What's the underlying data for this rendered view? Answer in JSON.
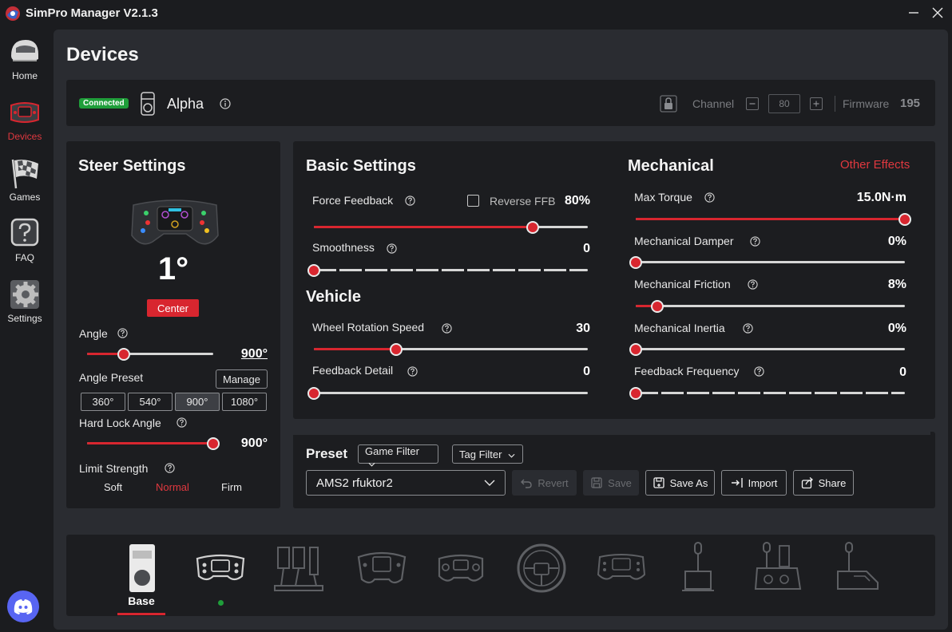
{
  "window": {
    "title": "SimPro Manager V2.1.3"
  },
  "nav": {
    "items": [
      {
        "label": "Home",
        "icon": "helmet-icon"
      },
      {
        "label": "Devices",
        "icon": "wheel-icon"
      },
      {
        "label": "Games",
        "icon": "checkered-flag-icon"
      },
      {
        "label": "FAQ",
        "icon": "question-icon"
      },
      {
        "label": "Settings",
        "icon": "gear-icon"
      }
    ],
    "active": "Devices"
  },
  "page": {
    "title": "Devices"
  },
  "device": {
    "status": "Connected",
    "name": "Alpha",
    "channel_label": "Channel",
    "channel_value": "80",
    "firmware_label": "Firmware",
    "firmware_value": "195"
  },
  "steer": {
    "title": "Steer Settings",
    "current_angle": "1°",
    "center_label": "Center",
    "angle": {
      "label": "Angle",
      "value": "900°",
      "fraction": 0.29
    },
    "angle_preset": {
      "label": "Angle Preset",
      "manage_label": "Manage",
      "options": [
        "360°",
        "540°",
        "900°",
        "1080°"
      ],
      "selected": "900°"
    },
    "hard_lock": {
      "label": "Hard Lock Angle",
      "value": "900°",
      "fraction": 1.0
    },
    "limit_strength": {
      "label": "Limit Strength",
      "options": [
        "Soft",
        "Normal",
        "Firm"
      ],
      "selected": "Normal"
    }
  },
  "basic": {
    "title": "Basic Settings",
    "force_feedback": {
      "label": "Force Feedback",
      "value": "80%",
      "fraction": 0.8
    },
    "reverse_ffb": {
      "label": "Reverse FFB",
      "checked": false
    },
    "smoothness": {
      "label": "Smoothness",
      "value": "0",
      "fraction": 0.0
    }
  },
  "vehicle": {
    "title": "Vehicle",
    "wheel_rotation_speed": {
      "label": "Wheel Rotation Speed",
      "value": "30",
      "fraction": 0.3
    },
    "feedback_detail": {
      "label": "Feedback Detail",
      "value": "0",
      "fraction": 0.0
    }
  },
  "mechanical": {
    "title": "Mechanical",
    "other_effects": "Other Effects",
    "max_torque": {
      "label": "Max Torque",
      "value": "15.0N·m",
      "fraction": 1.0
    },
    "damper": {
      "label": "Mechanical Damper",
      "value": "0%",
      "fraction": 0.0
    },
    "friction": {
      "label": "Mechanical Friction",
      "value": "8%",
      "fraction": 0.08
    },
    "inertia": {
      "label": "Mechanical Inertia",
      "value": "0%",
      "fraction": 0.0
    },
    "feedback_frequency": {
      "label": "Feedback Frequency",
      "value": "0",
      "fraction": 0.0
    }
  },
  "preset": {
    "title": "Preset",
    "game_filter": "Game Filter",
    "tag_filter": "Tag Filter",
    "selected": "AMS2 rfuktor2",
    "revert": "Revert",
    "save": "Save",
    "save_as": "Save As",
    "import": "Import",
    "share": "Share"
  },
  "devices_strip": {
    "items": [
      {
        "name": "base-device",
        "label": "Base"
      },
      {
        "name": "formula-wheel-device"
      },
      {
        "name": "pedals-device"
      },
      {
        "name": "gt-wheel-device"
      },
      {
        "name": "gamepad-wheel-device"
      },
      {
        "name": "round-wheel-device"
      },
      {
        "name": "f1-wheel-device"
      },
      {
        "name": "handbrake-device"
      },
      {
        "name": "sequential-shifter-device"
      },
      {
        "name": "h-shifter-device"
      }
    ],
    "selected": "Base"
  },
  "colors": {
    "accent": "#d8262f",
    "connected": "#1f9e3a",
    "panel": "#1c1d20",
    "background": "#2a2c31"
  }
}
